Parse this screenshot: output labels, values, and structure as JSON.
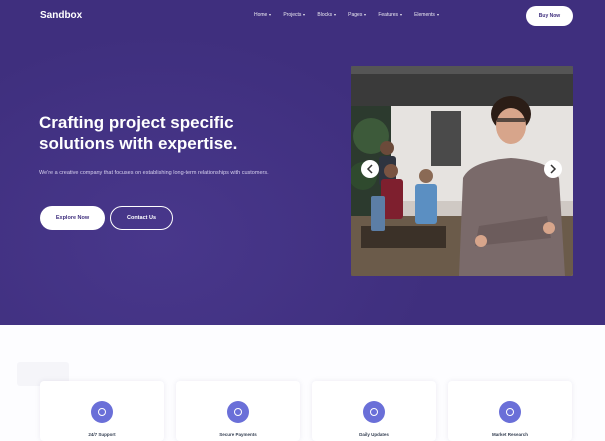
{
  "nav": {
    "brand": "Sandbox",
    "items": [
      {
        "label": "Home"
      },
      {
        "label": "Projects"
      },
      {
        "label": "Blocks"
      },
      {
        "label": "Pages"
      },
      {
        "label": "Features"
      },
      {
        "label": "Elements"
      }
    ],
    "cta": "Buy Now"
  },
  "hero": {
    "headline_line1": "Crafting project specific",
    "headline_line2": "solutions with expertise.",
    "lead": "We're a creative company that focuses on establishing long-term relationships with customers.",
    "primary_button": "Explore Now",
    "secondary_button": "Contact Us"
  },
  "features": {
    "cards": [
      {
        "title": "24/7 Support",
        "icon": "phone-icon"
      },
      {
        "title": "Secure Payments",
        "icon": "shield-icon"
      },
      {
        "title": "Daily Updates",
        "icon": "refresh-icon"
      },
      {
        "title": "Market Research",
        "icon": "chart-icon"
      }
    ]
  },
  "colors": {
    "hero_bg": "#3f2f7e",
    "accent": "#6a6fd8",
    "text_dark": "#343f52"
  }
}
